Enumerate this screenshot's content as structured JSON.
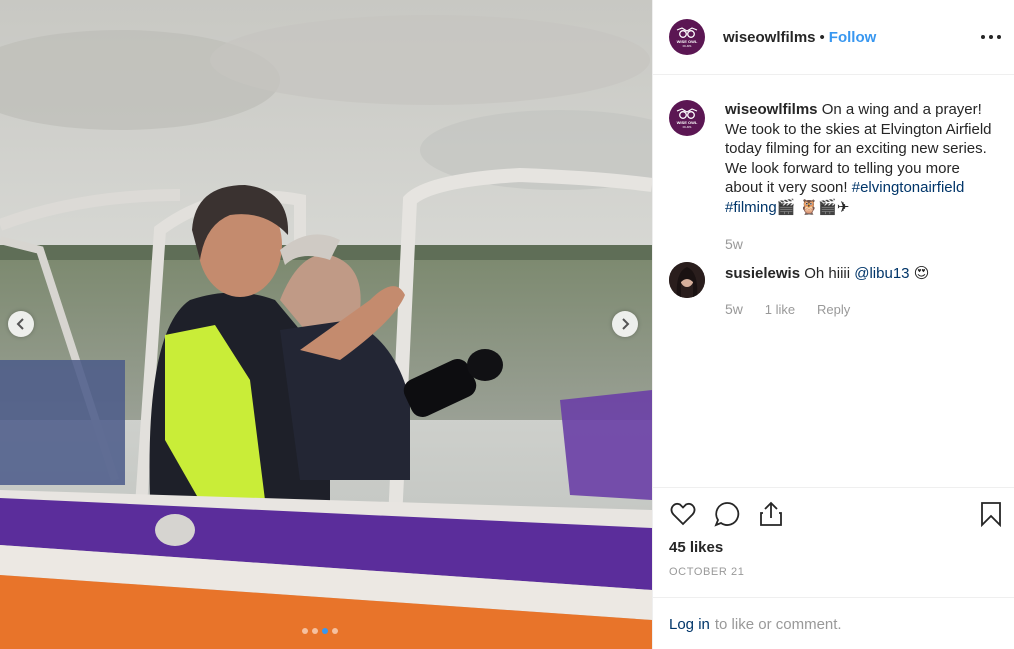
{
  "post": {
    "username": "wiseowlfilms",
    "separator": "•",
    "follow_label": "Follow",
    "avatar_text_top": "WISE OWL",
    "avatar_text_bottom": "FILMS"
  },
  "caption": {
    "username": "wiseowlfilms",
    "text": "On a wing and a prayer! We took to the skies at Elvington Airfield today filming for an exciting new series. We look forward to telling you more about it very soon!",
    "hashtag_1": "#elvingtonairfield",
    "hashtag_2": "#filming",
    "emojis": "🎬 🦉🎬✈",
    "time": "5w"
  },
  "comment": {
    "username": "susielewis",
    "text": "Oh hiiii",
    "mention": "@libu13",
    "emoji": "😍",
    "time": "5w",
    "likes": "1 like",
    "reply_label": "Reply"
  },
  "engagement": {
    "likes": "45 likes",
    "date": "OCTOBER 21",
    "login_label": "Log in",
    "login_suffix": "to like or comment."
  },
  "carousel": {
    "total": 4,
    "active": 3
  },
  "colors": {
    "brand": "#5b1653",
    "link": "#3897f0",
    "hashtag": "#003569",
    "muted": "#999999"
  },
  "icons": {
    "like": "heart-icon",
    "comment": "comment-icon",
    "share": "share-icon",
    "save": "bookmark-icon",
    "more": "more-options-icon",
    "prev": "chevron-left-icon",
    "next": "chevron-right-icon"
  }
}
